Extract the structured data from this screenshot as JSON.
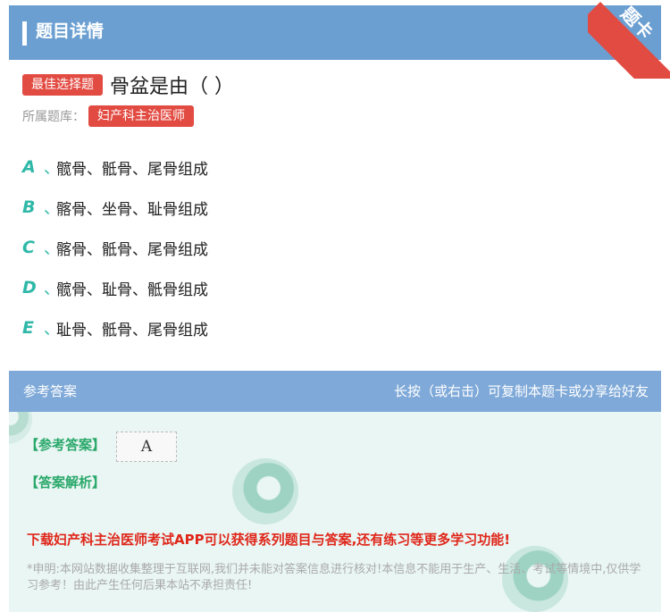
{
  "header": {
    "title": "题目详情",
    "corner_ribbon": "题卡"
  },
  "question": {
    "type_badge": "最佳选择题",
    "text": "骨盆是由（  ）",
    "bank_label": "所属题库：",
    "bank_name": "妇产科主治医师"
  },
  "options": [
    {
      "letter": "A",
      "sep": "、",
      "text": "髋骨、骶骨、尾骨组成"
    },
    {
      "letter": "B",
      "sep": "、",
      "text": "髂骨、坐骨、耻骨组成"
    },
    {
      "letter": "C",
      "sep": "、",
      "text": "髂骨、骶骨、尾骨组成"
    },
    {
      "letter": "D",
      "sep": "、",
      "text": "髋骨、耻骨、骶骨组成"
    },
    {
      "letter": "E",
      "sep": "、",
      "text": "耻骨、骶骨、尾骨组成"
    }
  ],
  "answer": {
    "bar_title": "参考答案",
    "bar_hint": "长按（或右击）可复制本题卡或分享给好友",
    "ref_label": "【参考答案】",
    "ref_value": "A",
    "explain_label": "【答案解析】",
    "promo": "下载妇产科主治医师考试APP可以获得系列题目与答案,还有练习等更多学习功能!",
    "disclaimer": "*申明:本网站数据收集整理于互联网,我们并未能对答案信息进行核对!本信息不能用于生产、生活、考试等情境中,仅供学习参考！由此产生任何后果本站不承担责任!"
  },
  "colors": {
    "header": "#6b9fd1",
    "accent_red": "#e24b42",
    "option_teal": "#2fb8a8",
    "answer_bar": "#7fa9d8",
    "answer_bg": "#e9f6f3"
  }
}
